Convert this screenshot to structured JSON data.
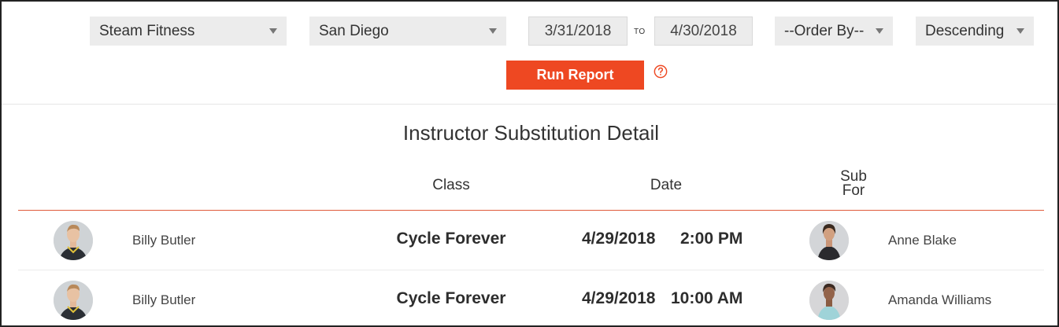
{
  "filters": {
    "studio": "Steam Fitness",
    "location": "San Diego",
    "date_from": "3/31/2018",
    "to_label": "TO",
    "date_to": "4/30/2018",
    "order_by": "--Order By--",
    "direction": "Descending"
  },
  "run_button_label": "Run Report",
  "report": {
    "title": "Instructor Substitution Detail",
    "columns": {
      "class": "Class",
      "date": "Date",
      "sub_for_line1": "Sub",
      "sub_for_line2": "For"
    },
    "rows": [
      {
        "instructor": "Billy Butler",
        "class": "Cycle Forever",
        "date": "4/29/2018",
        "time": "2:00 PM",
        "sub_for": "Anne Blake"
      },
      {
        "instructor": "Billy Butler",
        "class": "Cycle Forever",
        "date": "4/29/2018",
        "time": "10:00 AM",
        "sub_for": "Amanda Williams"
      }
    ]
  },
  "colors": {
    "accent": "#ee4822",
    "rule": "#e05a3a"
  }
}
